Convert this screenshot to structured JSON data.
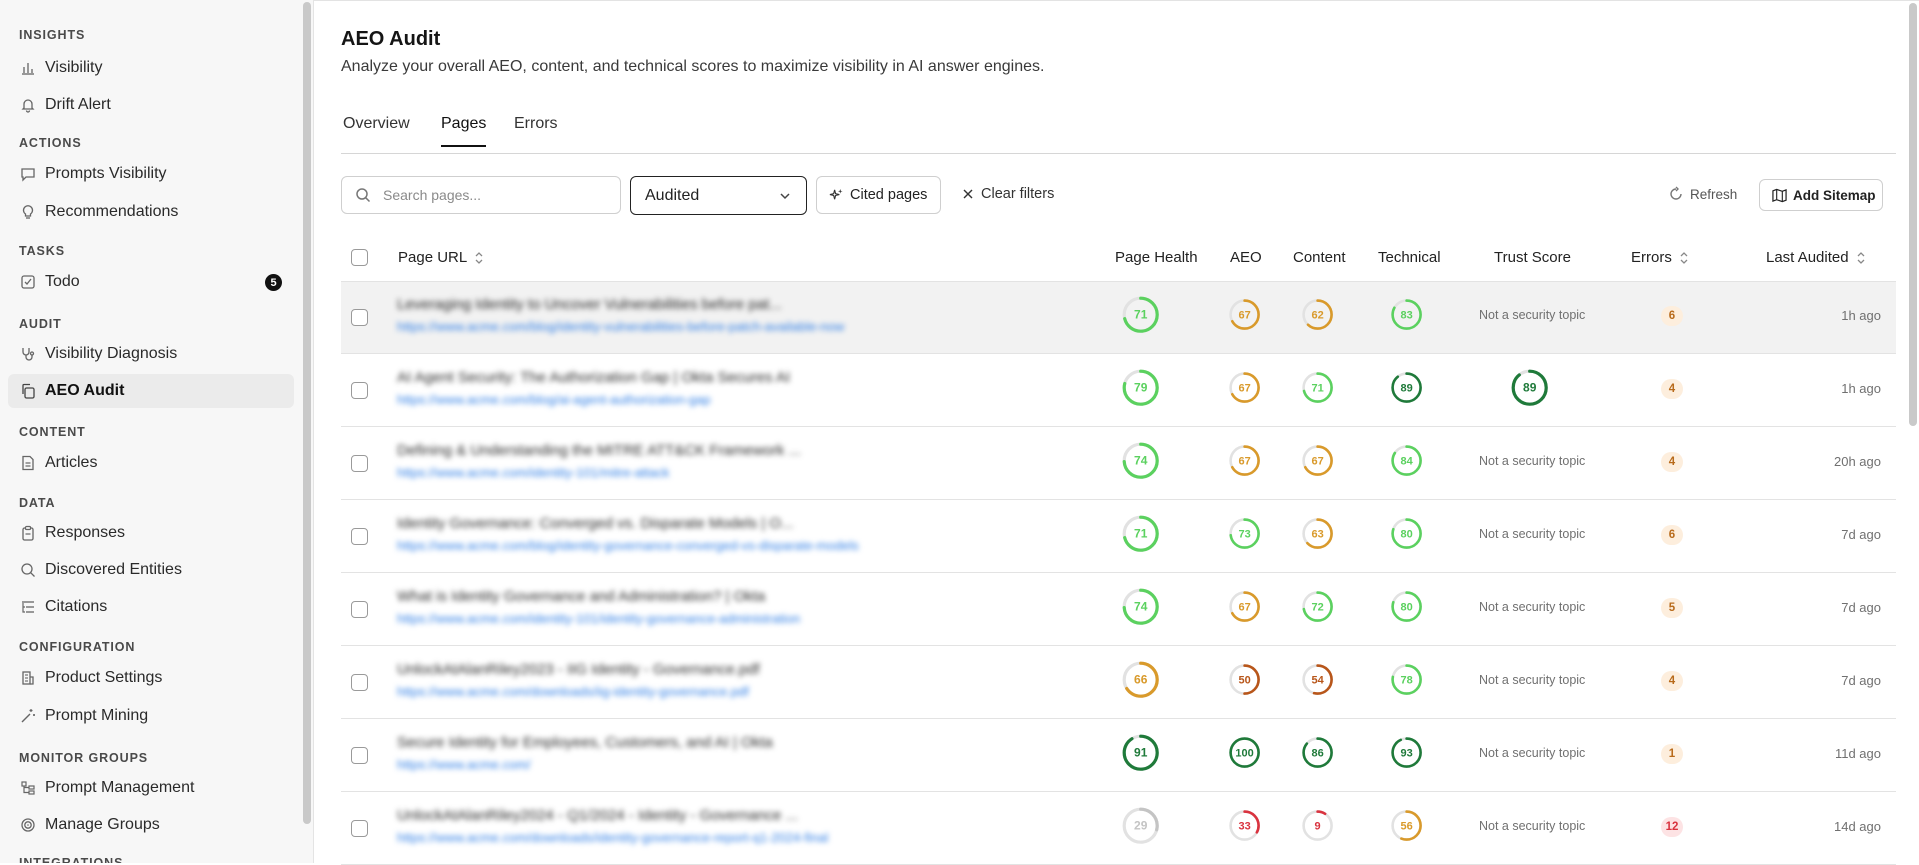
{
  "sidebar": {
    "sections": [
      {
        "title": "INSIGHTS",
        "items": [
          {
            "label": "Visibility",
            "icon": "bar-chart-icon"
          },
          {
            "label": "Drift Alert",
            "icon": "bell-icon"
          }
        ]
      },
      {
        "title": "ACTIONS",
        "items": [
          {
            "label": "Prompts Visibility",
            "icon": "message-icon"
          },
          {
            "label": "Recommendations",
            "icon": "lightbulb-icon"
          }
        ]
      },
      {
        "title": "TASKS",
        "items": [
          {
            "label": "Todo",
            "icon": "check-square-icon",
            "badge": "5"
          }
        ]
      },
      {
        "title": "AUDIT",
        "items": [
          {
            "label": "Visibility Diagnosis",
            "icon": "stethoscope-icon"
          },
          {
            "label": "AEO Audit",
            "icon": "copy-icon",
            "active": true
          }
        ]
      },
      {
        "title": "CONTENT",
        "items": [
          {
            "label": "Articles",
            "icon": "file-text-icon"
          }
        ]
      },
      {
        "title": "DATA",
        "items": [
          {
            "label": "Responses",
            "icon": "clipboard-icon"
          },
          {
            "label": "Discovered Entities",
            "icon": "search-icon"
          },
          {
            "label": "Citations",
            "icon": "list-tree-icon"
          }
        ]
      },
      {
        "title": "CONFIGURATION",
        "items": [
          {
            "label": "Product Settings",
            "icon": "building-icon"
          },
          {
            "label": "Prompt Mining",
            "icon": "wand-icon"
          }
        ]
      },
      {
        "title": "MONITOR GROUPS",
        "items": [
          {
            "label": "Prompt Management",
            "icon": "hierarchy-icon"
          },
          {
            "label": "Manage Groups",
            "icon": "target-icon"
          }
        ]
      },
      {
        "title": "INTEGRATIONS",
        "items": []
      }
    ]
  },
  "header": {
    "title": "AEO Audit",
    "subtitle": "Analyze your overall AEO, content, and technical scores to maximize visibility in AI answer engines."
  },
  "tabs": [
    {
      "label": "Overview",
      "active": false
    },
    {
      "label": "Pages",
      "active": true
    },
    {
      "label": "Errors",
      "active": false
    }
  ],
  "toolbar": {
    "search_placeholder": "Search pages...",
    "filter_value": "Audited",
    "cited_label": "Cited pages",
    "clear_label": "Clear filters",
    "refresh_label": "Refresh",
    "sitemap_label": "Add Sitemap"
  },
  "table": {
    "columns": {
      "url": "Page URL",
      "health": "Page Health",
      "aeo": "AEO",
      "content": "Content",
      "technical": "Technical",
      "trust": "Trust Score",
      "errors": "Errors",
      "last": "Last Audited"
    },
    "rows": [
      {
        "title": "Leveraging Identity to Uncover Vulnerabilities before pat...",
        "url": "https://www.acme.com/blog/identity-vulnerabilities-before-patch-available-now",
        "health": 71,
        "aeo": 67,
        "content": 62,
        "technical": 83,
        "trust": "Not a security topic",
        "errors": "6",
        "last": "1h ago",
        "highlight": true
      },
      {
        "title": "AI Agent Security: The Authorization Gap | Okta Secures AI",
        "url": "https://www.acme.com/blog/ai-agent-authorization-gap",
        "health": 79,
        "aeo": 67,
        "content": 71,
        "technical": 89,
        "trust": 89,
        "errors": "4",
        "last": "1h ago"
      },
      {
        "title": "Defining & Understanding the MITRE ATT&CK Framework ...",
        "url": "https://www.acme.com/identity-101/mitre-attack",
        "health": 74,
        "aeo": 67,
        "content": 67,
        "technical": 84,
        "trust": "Not a security topic",
        "errors": "4",
        "last": "20h ago"
      },
      {
        "title": "Identity Governance: Converged vs. Disparate Models | O...",
        "url": "https://www.acme.com/blog/identity-governance-converged-vs-disparate-models",
        "health": 71,
        "aeo": 73,
        "content": 63,
        "technical": 80,
        "trust": "Not a security topic",
        "errors": "6",
        "last": "7d ago"
      },
      {
        "title": "What is Identity Governance and Administration? | Okta",
        "url": "https://www.acme.com/identity-101/identity-governance-administration",
        "health": 74,
        "aeo": 67,
        "content": 72,
        "technical": 80,
        "trust": "Not a security topic",
        "errors": "5",
        "last": "7d ago"
      },
      {
        "title": "UnlockAtAlanRiley2023 - IIG Identity - Governance.pdf",
        "url": "https://www.acme.com/downloads/iig-identity-governance.pdf",
        "health": 66,
        "aeo": 50,
        "content": 54,
        "technical": 78,
        "trust": "Not a security topic",
        "errors": "4",
        "last": "7d ago"
      },
      {
        "title": "Secure Identity for Employees, Customers, and AI | Okta",
        "url": "https://www.acme.com/",
        "health": 91,
        "aeo": 100,
        "content": 86,
        "technical": 93,
        "trust": "Not a security topic",
        "errors": "1",
        "last": "11d ago"
      },
      {
        "title": "UnlockAtAlanRiley2024 - Q1/2024 - Identity - Governance ...",
        "url": "https://www.acme.com/downloads/identity-governance-report-q1-2024-final",
        "health": 29,
        "aeo": 33,
        "content": 9,
        "technical": 56,
        "trust": "Not a security topic",
        "errors": "12",
        "last": "14d ago"
      }
    ]
  },
  "colors": {
    "green_light": "#5bd15f",
    "green_dark": "#1f7a3a",
    "orange": "#d99a2b",
    "orange_dark": "#b8561a",
    "red": "#d9333f",
    "gray": "#c4c4c4",
    "badge_orange_bg": "#fdeedd",
    "badge_orange_fg": "#b86a1a",
    "badge_red_bg": "#fde3e4",
    "badge_red_fg": "#d9333f"
  }
}
